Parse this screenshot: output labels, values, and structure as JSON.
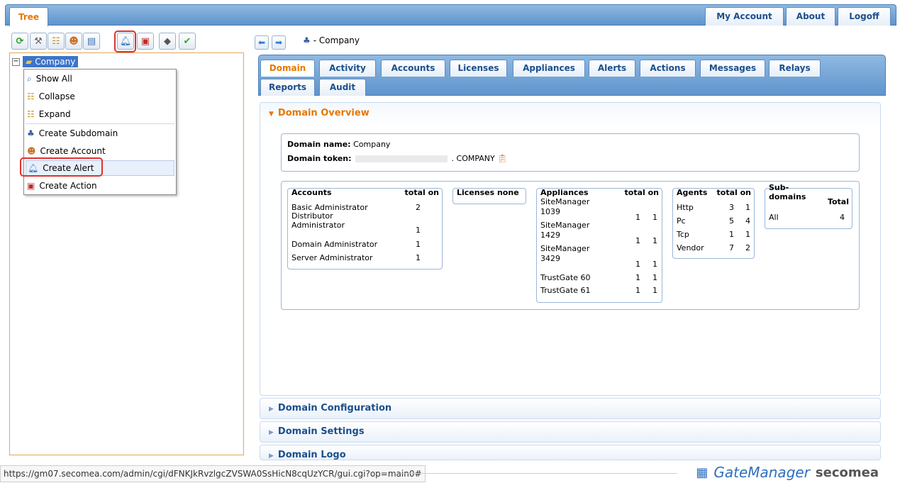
{
  "header": {
    "tree_tab": "Tree",
    "buttons": [
      "My Account",
      "About",
      "Logoff"
    ]
  },
  "toolbar": {
    "icons": [
      "refresh-icon",
      "tools-icon",
      "tree-icon",
      "account-icon",
      "message-icon",
      "alert-icon",
      "action-icon",
      "appliance-icon",
      "check-icon"
    ]
  },
  "tree": {
    "root_label": "Company",
    "expander": "−"
  },
  "context_menu": {
    "items": [
      {
        "label": "Show All",
        "icon": "magnifier-icon"
      },
      {
        "label": "Collapse",
        "icon": "collapse-tree-icon"
      },
      {
        "label": "Expand",
        "icon": "expand-tree-icon"
      },
      {
        "label": "Create Subdomain",
        "icon": "subdomain-icon"
      },
      {
        "label": "Create Account",
        "icon": "account-icon"
      },
      {
        "label": "Create Alert",
        "icon": "alert-icon"
      },
      {
        "label": "Create Action",
        "icon": "action-icon"
      }
    ]
  },
  "breadcrumb": {
    "text": "- Company"
  },
  "tabs": [
    "Domain",
    "Activity",
    "Accounts",
    "Licenses",
    "Appliances",
    "Alerts",
    "Actions",
    "Messages",
    "Relays",
    "Reports",
    "Audit"
  ],
  "overview": {
    "title": "Domain Overview",
    "domain_name_label": "Domain name:",
    "domain_name": "Company",
    "domain_token_label": "Domain token:",
    "domain_token_suffix": ". COMPANY"
  },
  "accounts": {
    "title": "Accounts",
    "cols": "total on",
    "rows": [
      {
        "name": "Basic Administrator",
        "total": "2",
        "on": ""
      },
      {
        "name": "Distributor Administrator",
        "total": "1",
        "on": ""
      },
      {
        "name": "Domain Administrator",
        "total": "1",
        "on": ""
      },
      {
        "name": "Server Administrator",
        "total": "1",
        "on": ""
      }
    ]
  },
  "licenses": {
    "title": "Licenses none"
  },
  "appliances": {
    "title": "Appliances",
    "cols": "total on",
    "rows": [
      {
        "name": "SiteManager 1039",
        "total": "1",
        "on": "1"
      },
      {
        "name": "SiteManager 1429",
        "total": "1",
        "on": "1"
      },
      {
        "name": "SiteManager 3429",
        "total": "1",
        "on": "1"
      },
      {
        "name": "TrustGate 60",
        "total": "1",
        "on": "1"
      },
      {
        "name": "TrustGate 61",
        "total": "1",
        "on": "1"
      }
    ]
  },
  "agents": {
    "title": "Agents",
    "cols": "total on",
    "rows": [
      {
        "name": "Http",
        "total": "3",
        "on": "1"
      },
      {
        "name": "Pc",
        "total": "5",
        "on": "4"
      },
      {
        "name": "Tcp",
        "total": "1",
        "on": "1"
      },
      {
        "name": "Vendor",
        "total": "7",
        "on": "2"
      }
    ]
  },
  "subdomains": {
    "title": "Sub-domains",
    "col": "Total",
    "row_label": "All",
    "row_value": "4"
  },
  "sections": [
    "Domain Configuration",
    "Domain Settings",
    "Domain Logo"
  ],
  "status": {
    "url": "https://gm07.secomea.com/admin/cgi/dFNKJkRvzlgcZVSWA0SsHicN8cqUzYCR/gui.cgi?op=main0#"
  },
  "brand": {
    "gatemanager": "GateManager",
    "secomea": "secomea"
  }
}
